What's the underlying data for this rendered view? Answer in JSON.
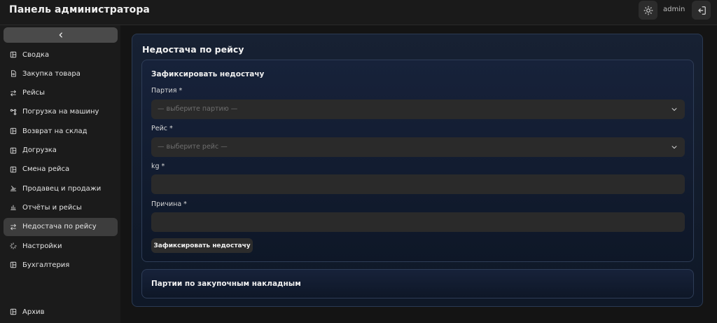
{
  "header": {
    "title": "Панель администратора",
    "username": "admin"
  },
  "sidebar": {
    "items": [
      {
        "label": "Сводка",
        "icon": "layout-panel-icon"
      },
      {
        "label": "Закупка товара",
        "icon": "file-text-icon"
      },
      {
        "label": "Рейсы",
        "icon": "arrows-swap-icon"
      },
      {
        "label": "Погрузка на машину",
        "icon": "nodes-icon"
      },
      {
        "label": "Возврат на склад",
        "icon": "layout-panel-icon"
      },
      {
        "label": "Догрузка",
        "icon": "layout-panel-icon"
      },
      {
        "label": "Смена рейса",
        "icon": "layout-panel-icon"
      },
      {
        "label": "Продавец и продажи",
        "icon": "seller-icon"
      },
      {
        "label": "Отчёты и рейсы",
        "icon": "bar-chart-icon"
      },
      {
        "label": "Недостача по рейсу",
        "icon": "arrows-swap-icon",
        "active": true
      },
      {
        "label": "Настройки",
        "icon": "loader-icon"
      },
      {
        "label": "Бухгалтерия",
        "icon": "layout-panel-icon"
      }
    ],
    "archive": {
      "label": "Архив",
      "icon": "layout-panel-icon"
    }
  },
  "main": {
    "title": "Недостача по рейсу",
    "form": {
      "title": "Зафиксировать недостачу",
      "batch_label": "Партия *",
      "batch_placeholder": "— выберите партию —",
      "trip_label": "Рейс *",
      "trip_placeholder": "— выберите рейс —",
      "kg_label": "kg *",
      "kg_value": "",
      "reason_label": "Причина *",
      "reason_value": "",
      "submit_label": "Зафиксировать недостачу"
    },
    "batches_section": {
      "title": "Партии по закупочным накладным"
    }
  },
  "colors": {
    "background": "#141414",
    "sidebar": "#1b1b1b",
    "active_item": "#3d3d3d",
    "panel": "#131d2e",
    "input": "#2a2a2a"
  }
}
